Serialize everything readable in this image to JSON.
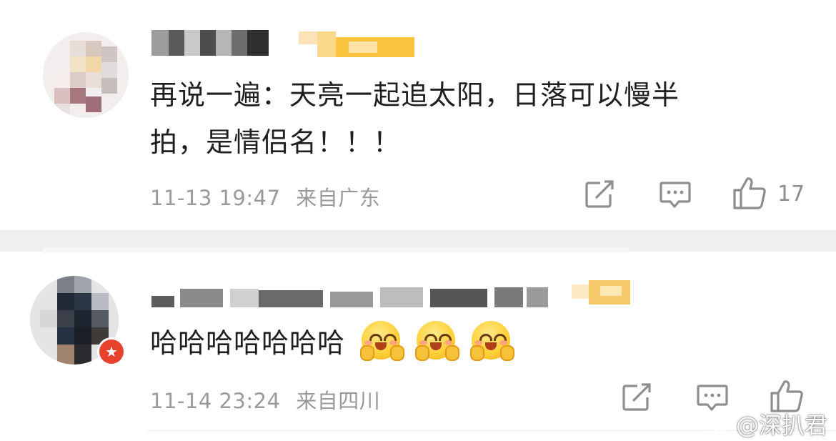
{
  "comments": [
    {
      "text_line1": "再说一遍：天亮一起追太阳，日落可以慢半",
      "text_line2": "拍，是情侣名！！！",
      "time": "11-13 19:47",
      "location": "来自广东",
      "like_count": "17"
    },
    {
      "text": "哈哈哈哈哈哈哈",
      "emoji_count": 3,
      "time": "11-14 23:24",
      "location": "来自四川",
      "like_count": ""
    }
  ],
  "icons": [
    "forward-icon",
    "comment-icon",
    "like-icon",
    "weibo-logo-icon"
  ],
  "colors": {
    "meta_text": "#9a9a9a",
    "badge_red": "#e8412c",
    "vip_gold": "#f7b52b",
    "divider": "#efefef"
  },
  "watermark": {
    "text": "@深扒君"
  }
}
